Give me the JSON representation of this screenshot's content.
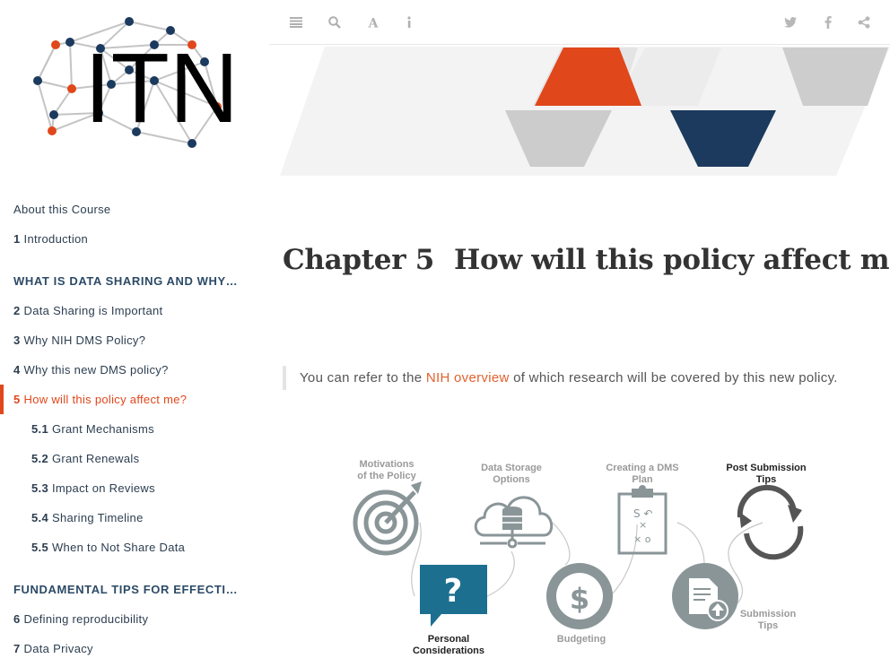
{
  "logo": {
    "text": "ITN"
  },
  "toolbar": {
    "left_icons": [
      "toc-toggle-icon",
      "search-icon",
      "font-settings-icon",
      "info-icon"
    ],
    "right_icons": [
      "twitter-icon",
      "facebook-icon",
      "share-icon"
    ]
  },
  "toc": {
    "about": {
      "label": "About this Course"
    },
    "intro": {
      "num": "1",
      "label": "Introduction"
    },
    "part1": {
      "label": "WHAT IS DATA SHARING AND WHY IS I..."
    },
    "ch2": {
      "num": "2",
      "label": "Data Sharing is Important"
    },
    "ch3": {
      "num": "3",
      "label": "Why NIH DMS Policy?"
    },
    "ch4": {
      "num": "4",
      "label": "Why this new DMS policy?"
    },
    "ch5": {
      "num": "5",
      "label": "How will this policy affect me?"
    },
    "s51": {
      "num": "5.1",
      "label": "Grant Mechanisms"
    },
    "s52": {
      "num": "5.2",
      "label": "Grant Renewals"
    },
    "s53": {
      "num": "5.3",
      "label": "Impact on Reviews"
    },
    "s54": {
      "num": "5.4",
      "label": "Sharing Timeline"
    },
    "s55": {
      "num": "5.5",
      "label": "When to Not Share Data"
    },
    "part2": {
      "label": "FUNDAMENTAL TIPS FOR EFFECTIVE D..."
    },
    "ch6": {
      "num": "6",
      "label": "Defining reproducibility"
    },
    "ch7": {
      "num": "7",
      "label": "Data Privacy"
    }
  },
  "main": {
    "chapter_label": "Chapter 5",
    "chapter_title": "How will this policy affect me?",
    "quote_before": "You can refer to the ",
    "quote_link": "NIH overview",
    "quote_after": " of which research will be covered by this new policy."
  },
  "infographic": {
    "motivations": "Motivations\nof the Policy",
    "storage": "Data Storage\nOptions",
    "creating": "Creating a DMS\nPlan",
    "post": "Post Submission\nTips",
    "personal": "Personal\nConsiderations",
    "budgeting": "Budgeting",
    "submission": "Submission\nTips"
  },
  "colors": {
    "accent": "#e0471b",
    "navy": "#1b3a5e",
    "teal": "#1d6f8f",
    "gray_icon": "#8a9598"
  }
}
